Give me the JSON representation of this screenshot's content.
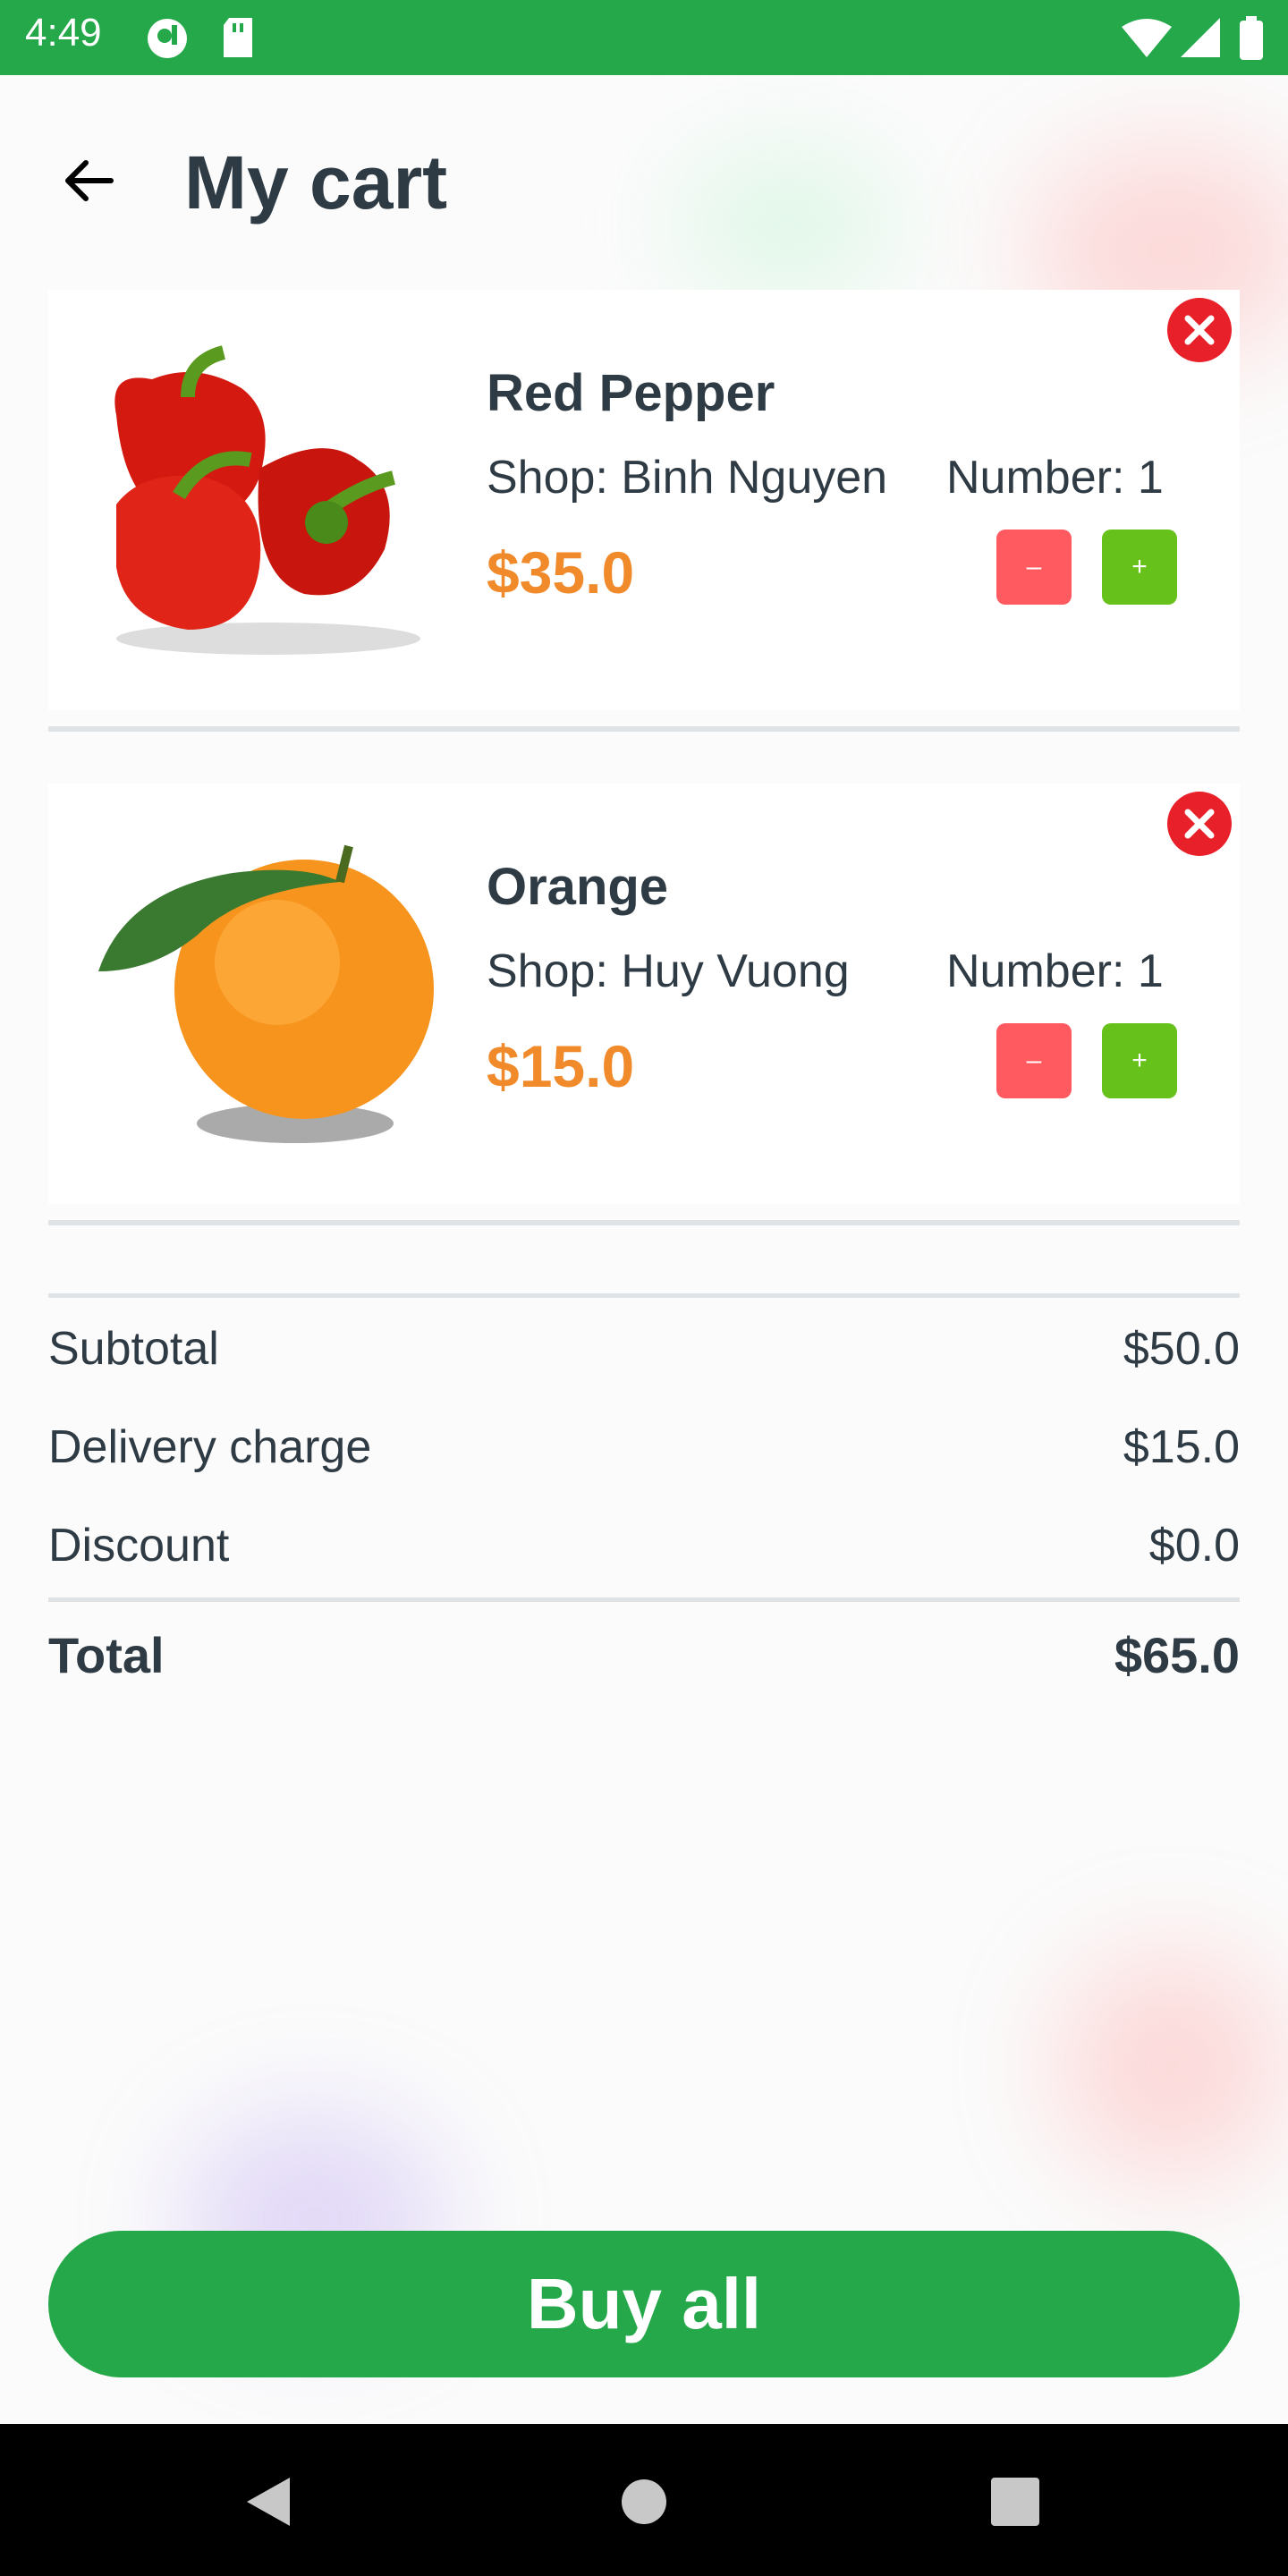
{
  "status_bar": {
    "time": "4:49"
  },
  "header": {
    "title": "My cart"
  },
  "cart": {
    "items": [
      {
        "name": "Red Pepper",
        "shop": "Shop: Binh Nguyen",
        "quantity": "Number: 1",
        "price": "$35.0",
        "minus_label": "–",
        "plus_label": "+"
      },
      {
        "name": "Orange",
        "shop": "Shop: Huy Vuong",
        "quantity": "Number: 1",
        "price": "$15.0",
        "minus_label": "–",
        "plus_label": "+"
      }
    ]
  },
  "summary": {
    "subtotal_label": "Subtotal",
    "subtotal_value": "$50.0",
    "delivery_label": "Delivery charge",
    "delivery_value": "$15.0",
    "discount_label": "Discount",
    "discount_value": "$0.0",
    "total_label": "Total",
    "total_value": "$65.0"
  },
  "actions": {
    "buy_all_label": "Buy all"
  },
  "colors": {
    "brand": "#25a84a",
    "price": "#f08a2a",
    "minus": "#ff5a5f",
    "plus": "#66c11a",
    "remove": "#e8202a"
  }
}
